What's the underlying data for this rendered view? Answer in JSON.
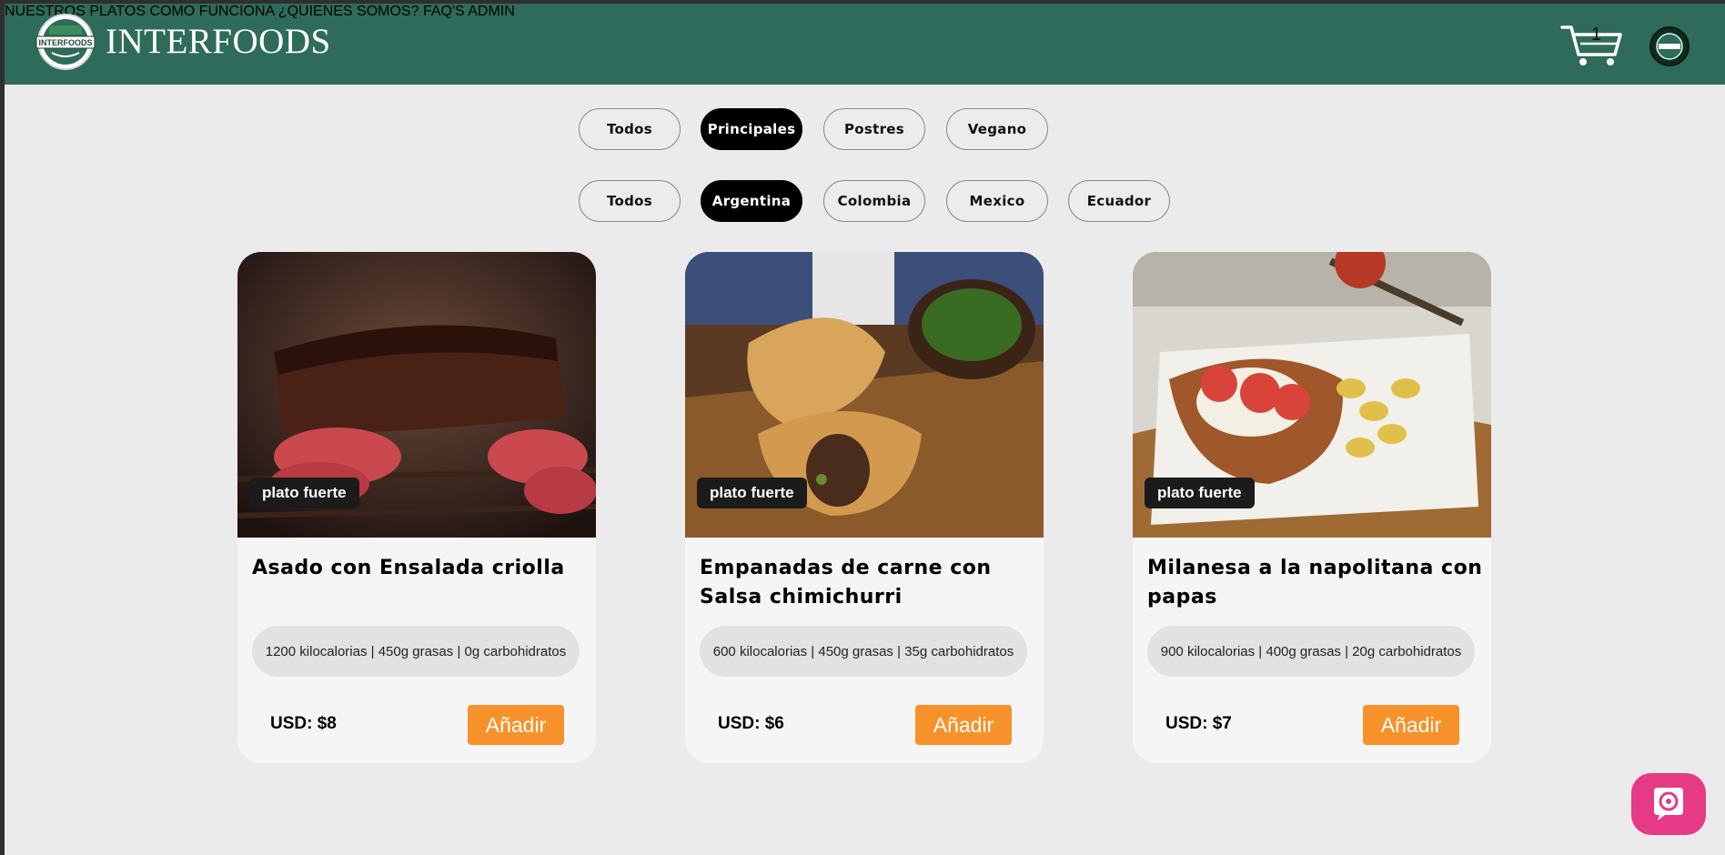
{
  "app": {
    "brand": "INTERFOODS",
    "logo_text": "INTERFOODS",
    "colors": {
      "header": "#2e6b5a",
      "accent_button": "#f7922a",
      "help_button": "#e63a86"
    }
  },
  "nav": {
    "items": [
      "NUESTROS PLATOS",
      "COMO FUNCIONA",
      "¿QUIENES SOMOS?",
      "FAQ'S",
      "ADMIN"
    ]
  },
  "cart": {
    "icon": "cart-icon",
    "count": "1"
  },
  "filters": {
    "category": {
      "options": [
        "Todos",
        "Principales",
        "Postres",
        "Vegano"
      ],
      "selected": "Principales"
    },
    "country": {
      "options": [
        "Todos",
        "Argentina",
        "Colombia",
        "Mexico",
        "Ecuador"
      ],
      "selected": "Argentina"
    }
  },
  "dishes": [
    {
      "tag": "plato fuerte",
      "name": "Asado con Ensalada criolla",
      "nutrition": "1200 kilocalorias | 450g grasas | 0g carbohidratos",
      "price": "USD: $8",
      "add_label": "Añadir"
    },
    {
      "tag": "plato fuerte",
      "name": "Empanadas de carne con Salsa chimichurri",
      "nutrition": "600 kilocalorias | 450g grasas | 35g carbohidratos",
      "price": "USD: $6",
      "add_label": "Añadir"
    },
    {
      "tag": "plato fuerte",
      "name": "Milanesa a la napolitana con papas",
      "nutrition": "900 kilocalorias | 400g grasas | 20g carbohidratos",
      "price": "USD: $7",
      "add_label": "Añadir"
    }
  ],
  "help": {
    "icon": "chat-help-icon"
  }
}
